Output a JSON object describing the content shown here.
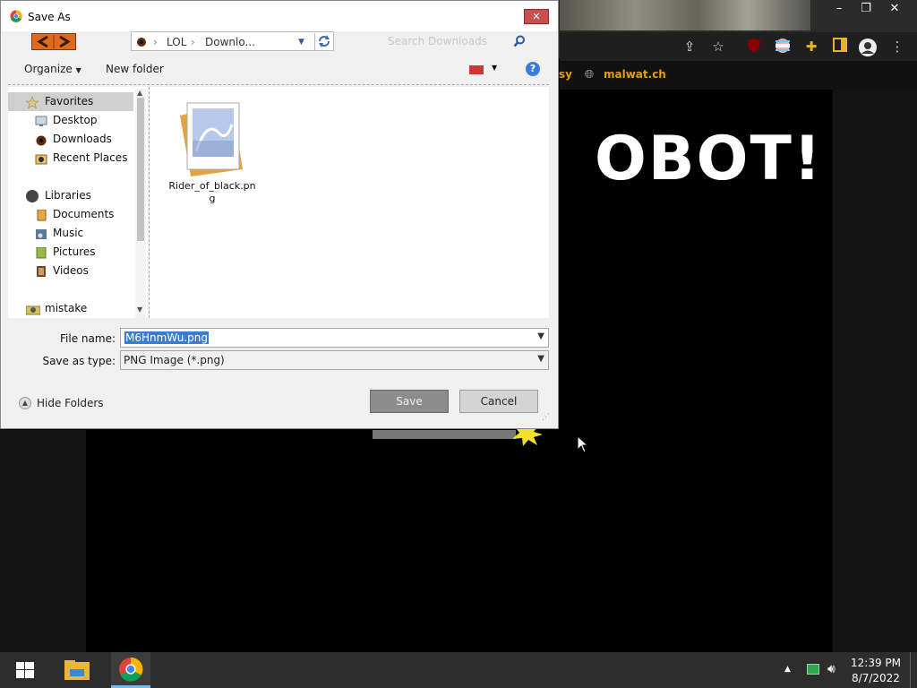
{
  "background_browser": {
    "window_controls": [
      "–",
      "❐",
      "✕"
    ],
    "toolbar_icons": [
      "share-icon",
      "star-icon",
      "ublock-icon",
      "flag-icon",
      "extensions-icon",
      "sidepanel-icon",
      "profile-icon",
      "menu-icon"
    ],
    "bookmarks": [
      {
        "label": "sy"
      },
      {
        "label": "malwat.ch"
      }
    ],
    "page": {
      "banner": "OBOT!"
    }
  },
  "dialog": {
    "title": "Save As",
    "close_label": "✕",
    "address_bar": {
      "crumbs": [
        "LOL",
        "Downlo..."
      ]
    },
    "search": {
      "placeholder": "Search Downloads"
    },
    "command_bar": {
      "organize": "Organize",
      "new_folder": "New folder"
    },
    "nav_pane": {
      "favorites_header": "Favorites",
      "favorites": [
        "Desktop",
        "Downloads",
        "Recent Places"
      ],
      "libraries_header": "Libraries",
      "libraries": [
        "Documents",
        "Music",
        "Pictures",
        "Videos"
      ],
      "other": "mistake"
    },
    "files": [
      {
        "name": "Rider_of_black.png"
      }
    ],
    "file_name": {
      "label": "File name:",
      "value": "M6HnmWu.png"
    },
    "save_as_type": {
      "label": "Save as type:",
      "value": "PNG Image (*.png)"
    },
    "hide_folders": "Hide Folders",
    "save_button": "Save",
    "cancel_button": "Cancel"
  },
  "taskbar": {
    "clock_time": "12:39 PM",
    "clock_date": "8/7/2022"
  }
}
